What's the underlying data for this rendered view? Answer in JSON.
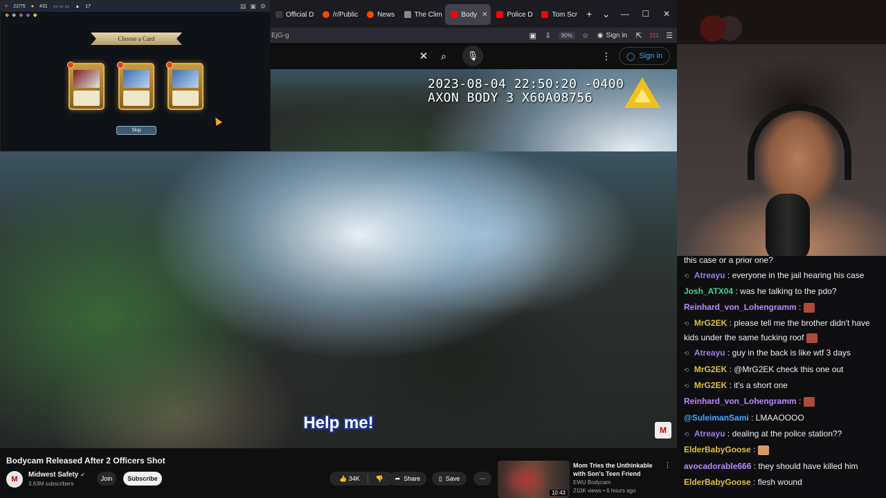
{
  "browser": {
    "tabs": [
      {
        "label": "Official D",
        "color": "#3a3a3a",
        "active": false
      },
      {
        "label": "/r/Public",
        "color": "#ff4500",
        "active": false
      },
      {
        "label": "News",
        "color": "#ff4500",
        "active": false
      },
      {
        "label": "The Clim",
        "color": "#888888",
        "active": false
      },
      {
        "label": "Body",
        "color": "#ff0000",
        "active": true
      },
      {
        "label": "Police D",
        "color": "#ff0000",
        "active": false
      },
      {
        "label": "Tom Scr",
        "color": "#ff0000",
        "active": false
      }
    ],
    "url_fragment": "EjG-g",
    "zoom": "90%",
    "signin_label": "Sign in",
    "mail_badge": "221"
  },
  "youtube": {
    "signin_label": "Sign in",
    "video": {
      "timestamp": "2023-08-04 22:50:20 -0400",
      "device": "AXON BODY 3 X60A08756",
      "caption": "Help me!"
    },
    "title": "Bodycam Released After 2 Officers Shot",
    "channel": {
      "name": "Midwest Safety",
      "subs": "3.63M subscribers",
      "avatar_letter": "M"
    },
    "join_label": "Join",
    "subscribe_label": "Subscribe",
    "likes": "34K",
    "share_label": "Share",
    "save_label": "Save",
    "recommended": {
      "title": "Mom Tries the Unthinkable with Son's Teen Friend",
      "channel": "EWU Bodycam",
      "meta": "210K views • 6 hours ago",
      "duration": "10:43"
    }
  },
  "game": {
    "hp": "22/75",
    "gold": "431",
    "floor": "17",
    "banner": "Choose a Card",
    "skip_label": "Skip"
  },
  "chat": [
    {
      "text": "this case or a prior one?",
      "user": "",
      "color": "#efeff1"
    },
    {
      "user": "Atreayu",
      "color": "#9b7fe6",
      "text": "everyone in the jail hearing his case",
      "badge": true
    },
    {
      "user": "Josh_ATX04",
      "color": "#3dd68c",
      "text": "was he talking to the pdo?"
    },
    {
      "user": "Reinhard_von_Lohengramm",
      "color": "#b98aff",
      "text": "",
      "emote": true
    },
    {
      "user": "MrG2EK",
      "color": "#e0c040",
      "text": "please tell me the brother didn't have kids under the same fucking roof",
      "badge": true,
      "emote": true
    },
    {
      "user": "Atreayu",
      "color": "#9b7fe6",
      "text": "guy in the back is like wtf 3 days",
      "badge": true
    },
    {
      "user": "MrG2EK",
      "color": "#e0c040",
      "text": "@MrG2EK check this one out",
      "badge": true
    },
    {
      "user": "MrG2EK",
      "color": "#e0c040",
      "text": "it's a short one",
      "badge": true
    },
    {
      "user": "Reinhard_von_Lohengramm",
      "color": "#b98aff",
      "text": "",
      "emote": true
    },
    {
      "user": "@SuleimanSami",
      "color": "#4aa8ff",
      "text": "LMAAOOOO"
    },
    {
      "user": "Atreayu",
      "color": "#9b7fe6",
      "text": "dealing at the police station??",
      "badge": true
    },
    {
      "user": "ElderBabyGoose",
      "color": "#e0c040",
      "text": "",
      "emote": true
    },
    {
      "user": "avocadorable666",
      "color": "#b98aff",
      "text": "they should have killed him"
    },
    {
      "user": "ElderBabyGoose",
      "color": "#e0c040",
      "text": "flesh wound"
    }
  ]
}
